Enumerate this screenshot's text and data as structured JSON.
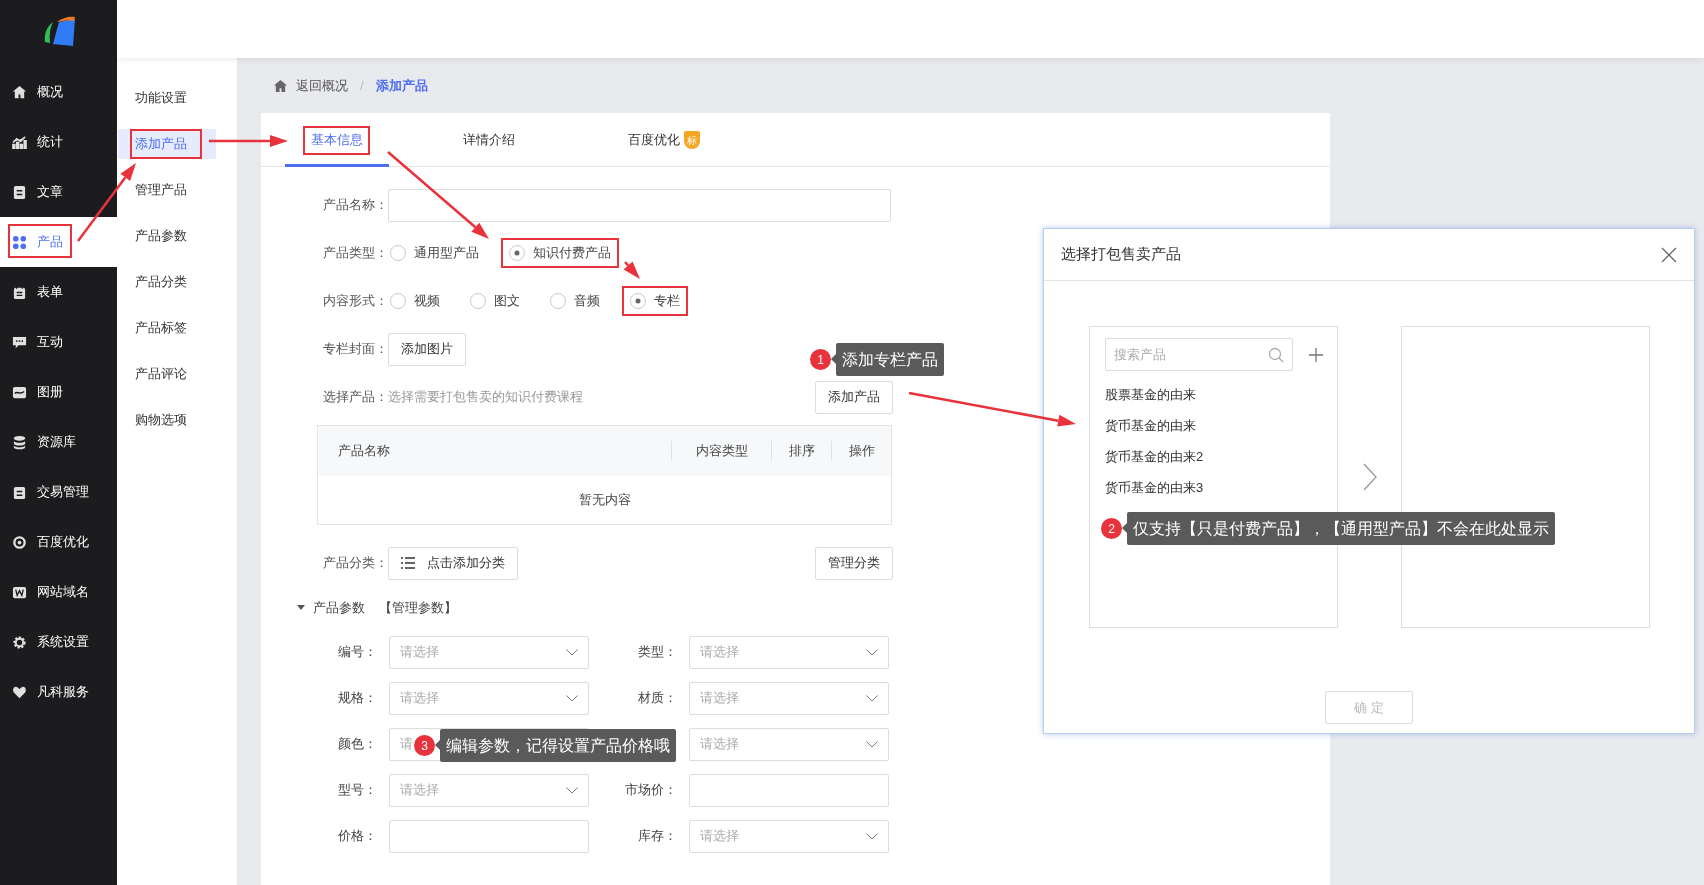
{
  "sidebar": {
    "items": [
      {
        "label": "概况",
        "selected": false,
        "highlighted": false
      },
      {
        "label": "统计",
        "selected": false,
        "highlighted": false
      },
      {
        "label": "文章",
        "selected": false,
        "highlighted": false
      },
      {
        "label": "产品",
        "selected": true,
        "highlighted": true
      },
      {
        "label": "表单",
        "selected": false,
        "highlighted": false
      },
      {
        "label": "互动",
        "selected": false,
        "highlighted": false
      },
      {
        "label": "图册",
        "selected": false,
        "highlighted": false
      },
      {
        "label": "资源库",
        "selected": false,
        "highlighted": false
      },
      {
        "label": "交易管理",
        "selected": false,
        "highlighted": false
      },
      {
        "label": "百度优化",
        "selected": false,
        "highlighted": false
      },
      {
        "label": "网站域名",
        "selected": false,
        "highlighted": false
      },
      {
        "label": "系统设置",
        "selected": false,
        "highlighted": false
      },
      {
        "label": "凡科服务",
        "selected": false,
        "highlighted": false
      }
    ]
  },
  "submenu": {
    "items": [
      {
        "label": "功能设置",
        "selected": false,
        "highlighted": false
      },
      {
        "label": "添加产品",
        "selected": true,
        "highlighted": true
      },
      {
        "label": "管理产品",
        "selected": false,
        "highlighted": false
      },
      {
        "label": "产品参数",
        "selected": false,
        "highlighted": false
      },
      {
        "label": "产品分类",
        "selected": false,
        "highlighted": false
      },
      {
        "label": "产品标签",
        "selected": false,
        "highlighted": false
      },
      {
        "label": "产品评论",
        "selected": false,
        "highlighted": false
      },
      {
        "label": "购物选项",
        "selected": false,
        "highlighted": false
      }
    ]
  },
  "breadcrumb": {
    "back": "返回概况",
    "separator": "/",
    "current": "添加产品"
  },
  "tabs": [
    {
      "label": "基本信息",
      "selected": true,
      "highlighted": true
    },
    {
      "label": "详情介绍",
      "selected": false,
      "highlighted": false
    },
    {
      "label": "百度优化",
      "selected": false,
      "highlighted": false,
      "badge": "标"
    }
  ],
  "form": {
    "name": {
      "label": "产品名称："
    },
    "type": {
      "label": "产品类型：",
      "options": [
        {
          "label": "通用型产品",
          "selected": false,
          "highlighted": false
        },
        {
          "label": "知识付费产品",
          "selected": true,
          "highlighted": true
        }
      ]
    },
    "content": {
      "label": "内容形式：",
      "options": [
        {
          "label": "视频",
          "selected": false,
          "highlighted": false
        },
        {
          "label": "图文",
          "selected": false,
          "highlighted": false
        },
        {
          "label": "音频",
          "selected": false,
          "highlighted": false
        },
        {
          "label": "专栏",
          "selected": true,
          "highlighted": true
        }
      ]
    },
    "cover": {
      "label": "专栏封面：",
      "button": "添加图片"
    },
    "select_product": {
      "label": "选择产品：",
      "hint": "选择需要打包售卖的知识付费课程",
      "button": "添加产品"
    },
    "table": {
      "columns": [
        "产品名称",
        "内容类型",
        "排序",
        "操作"
      ],
      "empty": "暂无内容"
    },
    "category": {
      "label": "产品分类：",
      "button": "点击添加分类",
      "manage_button": "管理分类"
    },
    "params": {
      "label": "产品参数",
      "link": "【管理参数】",
      "expanded": true,
      "fields": [
        {
          "label": "编号：",
          "kind": "select",
          "placeholder": "请选择"
        },
        {
          "label": "类型：",
          "kind": "select",
          "placeholder": "请选择"
        },
        {
          "label": "规格：",
          "kind": "select",
          "placeholder": "请选择"
        },
        {
          "label": "材质：",
          "kind": "select",
          "placeholder": "请选择"
        },
        {
          "label": "颜色：",
          "kind": "select",
          "placeholder": "请",
          "chevron": false
        },
        {
          "kind": "select",
          "placeholder": "请选择"
        },
        {
          "label": "型号：",
          "kind": "select",
          "placeholder": "请选择"
        },
        {
          "label": "市场价：",
          "kind": "input"
        },
        {
          "label": "价格：",
          "kind": "input"
        },
        {
          "label": "库存：",
          "kind": "select",
          "placeholder": "请选择"
        }
      ]
    }
  },
  "dialog": {
    "title": "选择打包售卖产品",
    "search_placeholder": "搜索产品",
    "items": [
      "股票基金的由来",
      "货币基金的由来",
      "货币基金的由来2",
      "货币基金的由来3"
    ],
    "confirm": "确 定"
  },
  "callouts": [
    {
      "number": "1",
      "text": "添加专栏产品"
    },
    {
      "number": "2",
      "text": "仅支持【只是付费产品】，【通用型产品】不会在此处显示"
    },
    {
      "number": "3",
      "text": "编辑参数，记得设置产品价格哦"
    }
  ]
}
